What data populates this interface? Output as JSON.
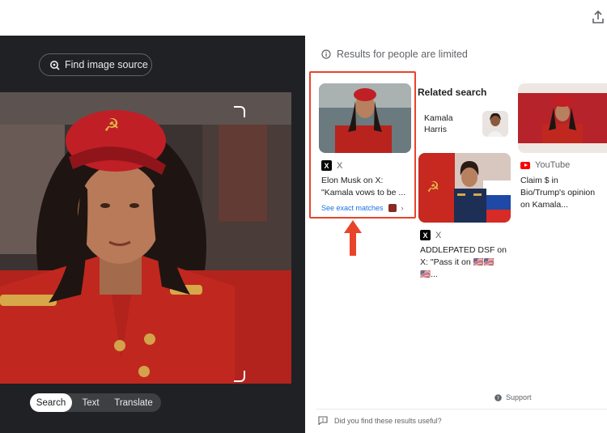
{
  "header": {
    "upload_icon": "upload-icon"
  },
  "lens": {
    "find_source_label": "Find image source",
    "modes": [
      {
        "label": "Search",
        "active": true
      },
      {
        "label": "Text",
        "active": false
      },
      {
        "label": "Translate",
        "active": false
      }
    ]
  },
  "results": {
    "notice": "Results for people are limited",
    "cards": [
      {
        "source": "X",
        "title": "Elon Musk on X: \"Kamala vows to be ...",
        "exact_label": "See exact matches"
      },
      {
        "source": "X",
        "title": "ADDLEPATED DSF on X: \"Pass it on 🇺🇸🇺🇸🇺🇸..."
      },
      {
        "source": "YouTube",
        "title": "Claim $ in Bio/Trump's opinion on Kamala..."
      }
    ],
    "related": {
      "heading": "Related search",
      "chip_label": "Kamala Harris"
    },
    "support_label": "Support",
    "feedback_label": "Did you find these results useful?"
  },
  "colors": {
    "accent": "#1a73e8",
    "highlight": "#e8442c",
    "dark_panel": "#202124"
  }
}
